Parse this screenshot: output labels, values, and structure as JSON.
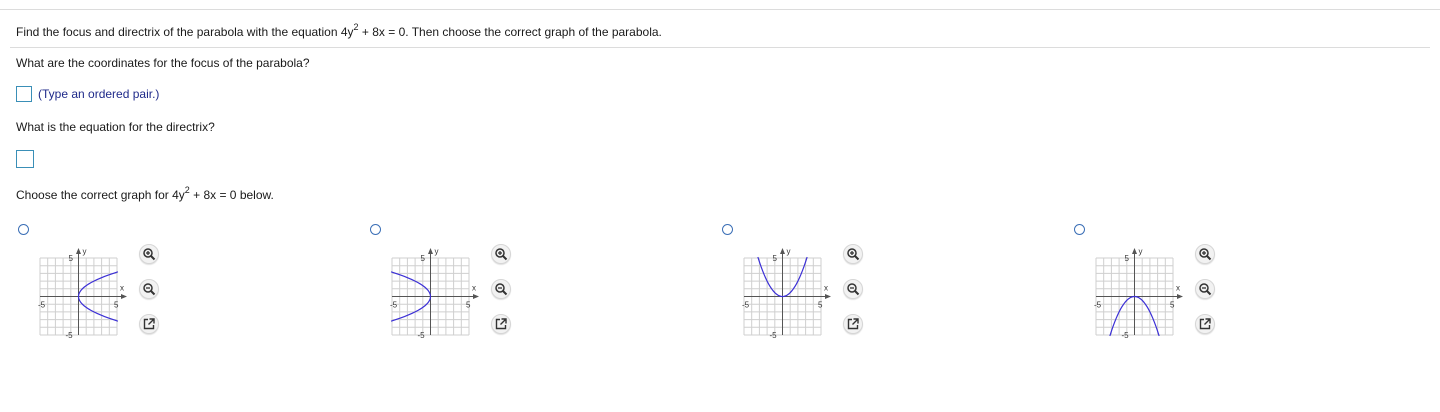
{
  "question": {
    "text_before_exp": "Find the focus and directrix of the parabola with the equation 4y",
    "exponent": "2",
    "text_after_exp": " + 8x = 0. Then choose the correct graph of the parabola."
  },
  "part_focus": {
    "prompt": "What are the coordinates for the focus of the parabola?",
    "hint": "(Type an ordered pair.)"
  },
  "part_directrix": {
    "prompt": "What is the equation for the directrix?"
  },
  "part_graph": {
    "prompt_before_exp": "Choose the correct graph for 4y",
    "exponent": "2",
    "prompt_after_exp": " + 8x = 0 below."
  },
  "options": [
    {
      "curve": "opens-right",
      "axis_y": "y",
      "axis_x": "x",
      "tick_pos": "5",
      "tick_neg": "-5"
    },
    {
      "curve": "opens-left",
      "axis_y": "y",
      "axis_x": "x",
      "tick_pos": "5",
      "tick_neg": "-5"
    },
    {
      "curve": "opens-up",
      "axis_y": "y",
      "axis_x": "x",
      "tick_pos": "5",
      "tick_neg": "-5"
    },
    {
      "curve": "opens-down",
      "axis_y": "y",
      "axis_x": "x",
      "tick_pos": "5",
      "tick_neg": "-5"
    }
  ],
  "tools": {
    "zoom_in": "zoom-in-icon",
    "zoom_out": "zoom-out-icon",
    "popout": "popout-icon"
  },
  "colors": {
    "curve": "#3b2fd6",
    "grid": "#cfcfcf",
    "axis": "#555555",
    "input_border": "#3a8fb7",
    "radio_border": "#3b6fb6"
  }
}
